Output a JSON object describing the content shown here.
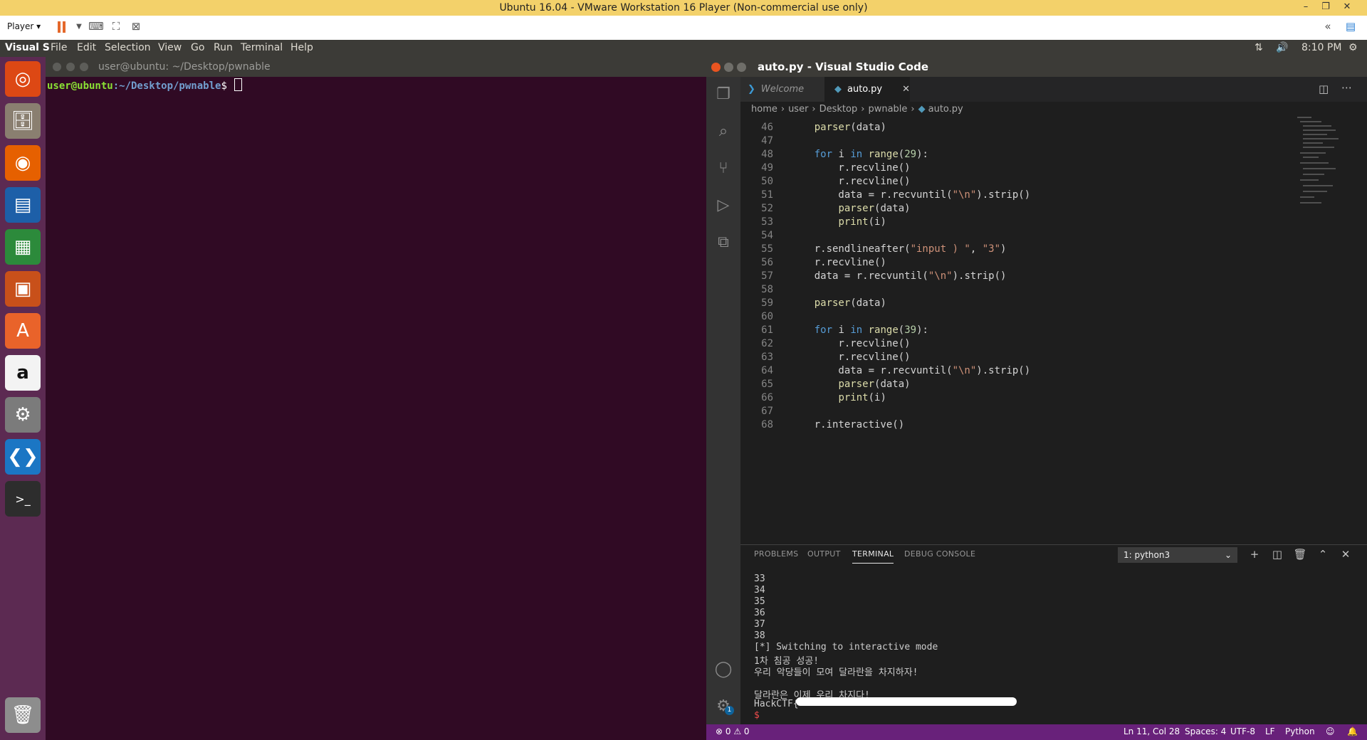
{
  "vm": {
    "title": "Ubuntu 16.04 - VMware Workstation 16 Player (Non-commercial use only)",
    "player_label": "Player ▾"
  },
  "ubuntu": {
    "menu": [
      "Visual S",
      "File",
      "Edit",
      "Selection",
      "View",
      "Go",
      "Run",
      "Terminal",
      "Help"
    ],
    "clock": "8:10 PM"
  },
  "terminal": {
    "title": "user@ubuntu: ~/Desktop/pwnable",
    "prompt_user": "user@ubuntu",
    "prompt_path": ":~/Desktop/pwnable",
    "prompt_symbol": "$"
  },
  "vscode": {
    "window_title": "auto.py - Visual Studio Code",
    "tabs": [
      {
        "label": "Welcome"
      },
      {
        "label": "auto.py"
      }
    ],
    "breadcrumb": [
      "home",
      "user",
      "Desktop",
      "pwnable",
      "auto.py"
    ],
    "code": [
      {
        "n": "46",
        "text": "    parser(data)"
      },
      {
        "n": "47",
        "text": ""
      },
      {
        "n": "48",
        "text": "    for i in range(29):"
      },
      {
        "n": "49",
        "text": "        r.recvline()"
      },
      {
        "n": "50",
        "text": "        r.recvline()"
      },
      {
        "n": "51",
        "text": "        data = r.recvuntil(\"\\n\").strip()"
      },
      {
        "n": "52",
        "text": "        parser(data)"
      },
      {
        "n": "53",
        "text": "        print(i)"
      },
      {
        "n": "54",
        "text": ""
      },
      {
        "n": "55",
        "text": "    r.sendlineafter(\"input ) \", \"3\")"
      },
      {
        "n": "56",
        "text": "    r.recvline()"
      },
      {
        "n": "57",
        "text": "    data = r.recvuntil(\"\\n\").strip()"
      },
      {
        "n": "58",
        "text": ""
      },
      {
        "n": "59",
        "text": "    parser(data)"
      },
      {
        "n": "60",
        "text": ""
      },
      {
        "n": "61",
        "text": "    for i in range(39):"
      },
      {
        "n": "62",
        "text": "        r.recvline()"
      },
      {
        "n": "63",
        "text": "        r.recvline()"
      },
      {
        "n": "64",
        "text": "        data = r.recvuntil(\"\\n\").strip()"
      },
      {
        "n": "65",
        "text": "        parser(data)"
      },
      {
        "n": "66",
        "text": "        print(i)"
      },
      {
        "n": "67",
        "text": ""
      },
      {
        "n": "68",
        "text": "    r.interactive()"
      }
    ],
    "panel_tabs": [
      "PROBLEMS",
      "OUTPUT",
      "TERMINAL",
      "DEBUG CONSOLE"
    ],
    "terminal_select": "1: python3",
    "terminal_output": [
      "33",
      "34",
      "35",
      "36",
      "37",
      "38",
      "[*] Switching to interactive mode",
      "1차 침공 성공!",
      "우리 악당들이 모여 달라란을 차지하자!",
      "",
      "달라란은 이제 우리 차지다!",
      "HackCTF{",
      "$ "
    ],
    "status": {
      "problems": "⊗ 0 ⚠ 0",
      "position": "Ln 11, Col 28",
      "spaces": "Spaces: 4",
      "encoding": "UTF-8",
      "eol": "LF",
      "language": "Python"
    },
    "settings_badge": "1"
  },
  "colors": {
    "vscode_status": "#68217a",
    "ubuntu_terminal_bg": "#300a24",
    "launcher": "#5c2a52"
  }
}
